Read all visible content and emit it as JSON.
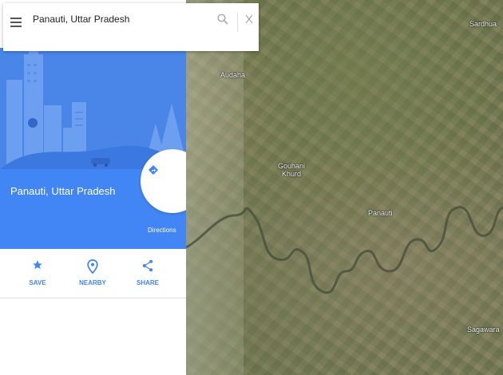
{
  "search": {
    "value": "Panauti, Uttar Pradesh",
    "menu_icon": "hamburger-icon",
    "search_icon": "search-icon",
    "close_icon": "close-icon"
  },
  "place": {
    "title": "Panauti, Uttar Pradesh",
    "directions_label": "Directions",
    "directions_icon": "directions-icon"
  },
  "actions": [
    {
      "label": "SAVE",
      "icon": "star-icon"
    },
    {
      "label": "NEARBY",
      "icon": "location-pin-icon"
    },
    {
      "label": "SHARE",
      "icon": "share-icon"
    }
  ],
  "map": {
    "labels": [
      "Audaha",
      "Gouhani\nKhurd",
      "Panauti",
      "Sardhua",
      "Sagawara"
    ]
  },
  "colors": {
    "accent": "#4285f4",
    "hero": "#4a86e8"
  }
}
